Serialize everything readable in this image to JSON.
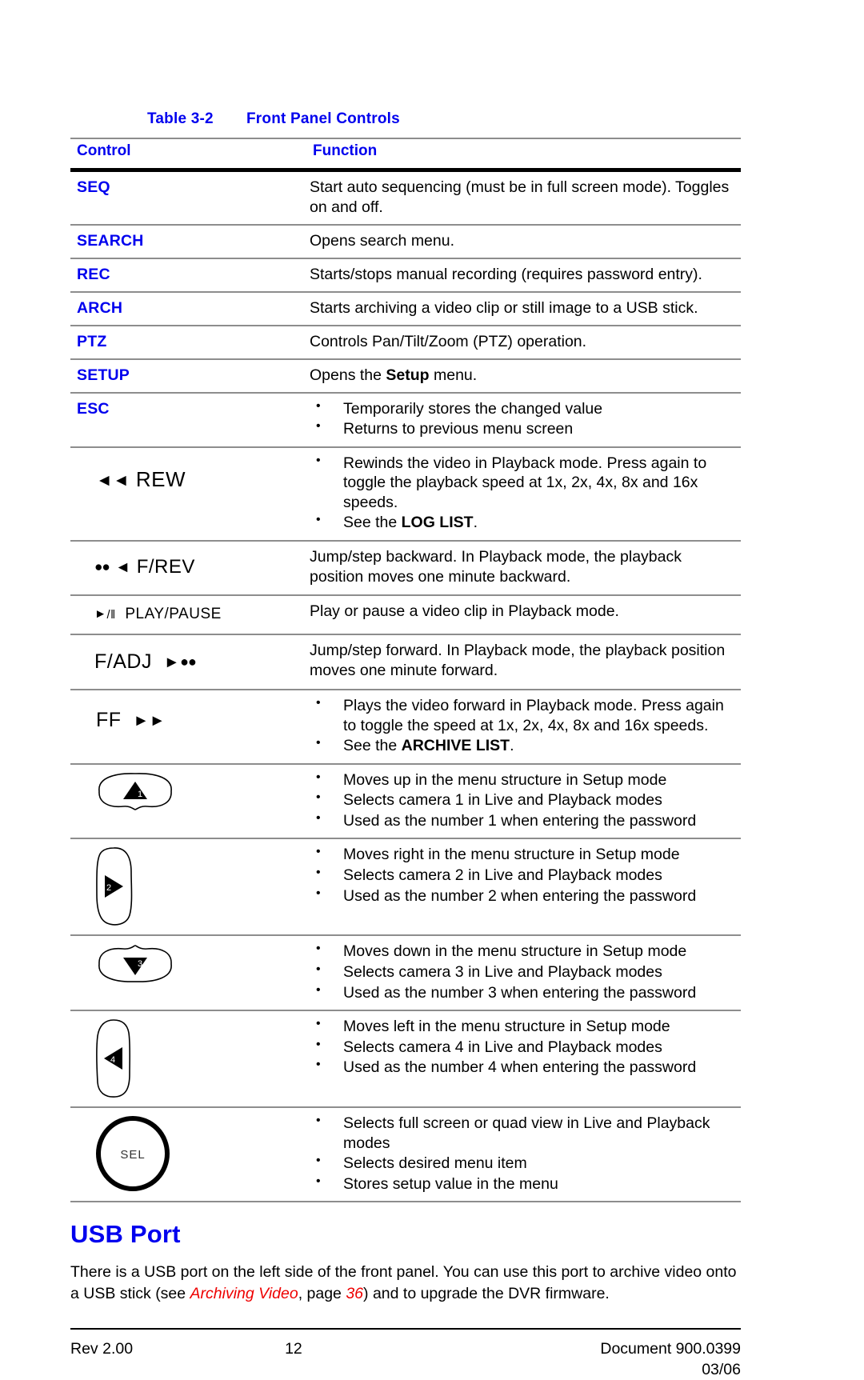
{
  "table": {
    "caption_number": "Table 3-2",
    "caption_title": "Front Panel Controls",
    "headers": {
      "control": "Control",
      "function": "Function"
    },
    "rows": [
      {
        "control_label": "SEQ",
        "control_type": "text",
        "function_type": "paragraph",
        "function_text": "Start auto sequencing (must be in full screen mode). Toggles on and off."
      },
      {
        "control_label": "SEARCH",
        "control_type": "text",
        "function_type": "paragraph",
        "function_text": "Opens search menu."
      },
      {
        "control_label": "REC",
        "control_type": "text",
        "function_type": "paragraph",
        "function_text": "Starts/stops manual recording (requires password entry)."
      },
      {
        "control_label": "ARCH",
        "control_type": "text",
        "function_type": "paragraph",
        "function_text": "Starts archiving a video clip or still image to a USB stick."
      },
      {
        "control_label": "PTZ",
        "control_type": "text",
        "function_type": "paragraph",
        "function_text": "Controls Pan/Tilt/Zoom (PTZ) operation."
      },
      {
        "control_label": "SETUP",
        "control_type": "text",
        "function_type": "rich",
        "function_parts": [
          "Opens the ",
          "Setup",
          " menu."
        ]
      },
      {
        "control_label": "ESC",
        "control_type": "text",
        "function_type": "bullets",
        "bullets": [
          "Temporarily stores the changed value",
          "Returns to previous menu screen"
        ]
      },
      {
        "control_label": "REW",
        "control_type": "symbol",
        "symbol_prefix": "◄◄",
        "function_type": "bullets_rich",
        "bullets": [
          "Rewinds the video in Playback mode. Press again to toggle the playback speed at 1x, 2x, 4x, 8x and 16x speeds.",
          "See the LOG LIST."
        ],
        "bullet_bold_term": "LOG LIST"
      },
      {
        "control_label": "F/REV",
        "control_type": "symbol",
        "symbol_prefix": "●● ◄",
        "function_type": "paragraph",
        "function_text": "Jump/step backward. In Playback mode, the playback position moves one minute backward."
      },
      {
        "control_label": "PLAY/PAUSE",
        "control_type": "symbol",
        "symbol_prefix": "►/‖",
        "function_type": "paragraph",
        "function_text": "Play or pause a video clip in Playback mode."
      },
      {
        "control_label": "F/ADJ",
        "control_type": "symbol",
        "symbol_suffix": "► ●●",
        "function_type": "paragraph",
        "function_text": "Jump/step forward. In Playback mode, the playback position moves one minute forward."
      },
      {
        "control_label": "FF",
        "control_type": "symbol",
        "symbol_suffix": "►►",
        "function_type": "bullets_rich",
        "bullets": [
          "Plays the video forward in Playback mode. Press again to toggle the speed at 1x, 2x, 4x, 8x and 16x speeds.",
          "See the ARCHIVE LIST."
        ],
        "bullet_bold_term": "ARCHIVE LIST"
      },
      {
        "control_label": "up-button",
        "control_type": "button-up",
        "button_number": "1",
        "function_type": "bullets",
        "bullets": [
          "Moves up in the menu structure in Setup mode",
          "Selects camera 1 in Live and Playback modes",
          "Used as the number 1 when entering the password"
        ]
      },
      {
        "control_label": "right-button",
        "control_type": "button-right",
        "button_number": "2",
        "function_type": "bullets",
        "bullets": [
          "Moves right in the menu structure in Setup mode",
          "Selects camera 2 in Live and Playback modes",
          "Used as the number 2 when entering the password"
        ]
      },
      {
        "control_label": "down-button",
        "control_type": "button-down",
        "button_number": "3",
        "function_type": "bullets",
        "bullets": [
          "Moves down in the menu structure in Setup mode",
          "Selects camera 3 in Live and Playback modes",
          "Used as the number 3 when entering the password"
        ]
      },
      {
        "control_label": "left-button",
        "control_type": "button-left",
        "button_number": "4",
        "function_type": "bullets",
        "bullets": [
          "Moves left in the menu structure in Setup mode",
          "Selects camera 4 in Live and Playback modes",
          "Used as the number 4 when entering the password"
        ]
      },
      {
        "control_label": "SEL",
        "control_type": "button-sel",
        "button_text": "SEL",
        "function_type": "bullets",
        "bullets": [
          "Selects full screen or quad view in Live and Playback modes",
          "Selects desired menu item",
          "Stores setup value in the menu"
        ]
      }
    ]
  },
  "usb_section": {
    "heading": "USB Port",
    "para_part1": "There is a USB port on the left side of the front panel. You can use this port to archive video onto a USB stick (see ",
    "xref_title": "Archiving Video",
    "para_part2": ", page ",
    "xref_page": "36",
    "para_part3": ") and to upgrade the DVR firmware."
  },
  "footer": {
    "revision": "Rev 2.00",
    "page_number": "12",
    "document_id": "Document 900.0399",
    "document_date": "03/06"
  },
  "colors": {
    "heading_blue": "#0000ee",
    "xref_red": "#ee0000",
    "rule_gray": "#8d8d8d"
  }
}
